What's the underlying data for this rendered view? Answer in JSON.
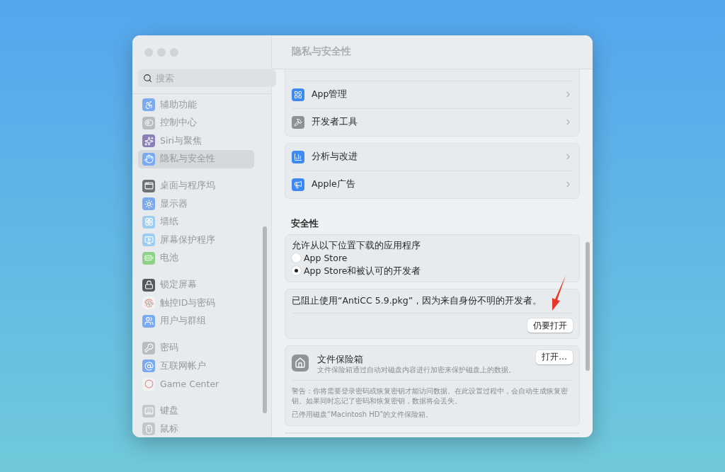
{
  "window": {
    "title": "隐私与安全性"
  },
  "sidebar": {
    "search": {
      "placeholder": "搜索"
    },
    "groups": [
      {
        "items": [
          {
            "label": "辅助功能",
            "selected": false,
            "color": "#7aaaf2"
          },
          {
            "label": "控制中心",
            "selected": false,
            "color": "#b9bcc0"
          },
          {
            "label": "Siri与聚焦",
            "selected": false,
            "color": "#8a7fb8"
          },
          {
            "label": "隐私与安全性",
            "selected": true,
            "color": "#7aaaf2"
          }
        ]
      },
      {
        "items": [
          {
            "label": "桌面与程序坞",
            "selected": false,
            "color": "#6e7276"
          },
          {
            "label": "显示器",
            "selected": false,
            "color": "#7aaaf2"
          },
          {
            "label": "墙纸",
            "selected": false,
            "color": "#9fcdf0"
          },
          {
            "label": "屏幕保护程序",
            "selected": false,
            "color": "#9fcdf0"
          },
          {
            "label": "电池",
            "selected": false,
            "color": "#8ed28a"
          }
        ]
      },
      {
        "items": [
          {
            "label": "锁定屏幕",
            "selected": false,
            "color": "#55585c"
          },
          {
            "label": "触控ID与密码",
            "selected": false,
            "color": "#f2f2f2"
          },
          {
            "label": "用户与群组",
            "selected": false,
            "color": "#7aaaf2"
          }
        ]
      },
      {
        "items": [
          {
            "label": "密码",
            "selected": false,
            "color": "#b9bcc0"
          },
          {
            "label": "互联网帐户",
            "selected": false,
            "color": "#7aaaf2"
          },
          {
            "label": "Game Center",
            "selected": false,
            "color": "#f2f2f2"
          }
        ]
      },
      {
        "items": [
          {
            "label": "键盘",
            "selected": false,
            "color": "#c4c7ca"
          },
          {
            "label": "鼠标",
            "selected": false,
            "color": "#c4c7ca"
          }
        ]
      }
    ]
  },
  "nav_groups": [
    {
      "items": [
        {
          "label": "App管理"
        },
        {
          "label": "开发者工具"
        }
      ]
    },
    {
      "items": [
        {
          "label": "分析与改进"
        },
        {
          "label": "Apple广告"
        }
      ]
    }
  ],
  "security": {
    "heading": "安全性",
    "download": {
      "label": "允许从以下位置下载的应用程序",
      "options": [
        {
          "label": "App Store",
          "selected": false
        },
        {
          "label": "App Store和被认可的开发者",
          "selected": true
        }
      ]
    },
    "blocked": {
      "message": "已阻止使用“AntiCC 5.9.pkg”，因为来自身份不明的开发者。",
      "button": "仍要打开"
    },
    "filevault": {
      "title": "文件保险箱",
      "description": "文件保险箱通过自动对磁盘内容进行加密来保护磁盘上的数据。",
      "button": "打开…",
      "warning": "警告：你将需要登录密码或恢复密钥才能访问数据。在此设置过程中，会自动生成恢复密钥。如果同时忘记了密码和恢复密钥，数据将会丢失。",
      "status": "已停用磁盘“Macintosh HD”的文件保险箱。"
    }
  }
}
